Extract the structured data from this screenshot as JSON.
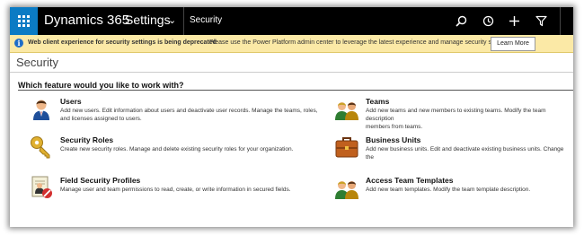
{
  "colors": {
    "nav_background": "#000000",
    "waffle_background": "#0b7bc4",
    "banner_background": "#fbe9a6",
    "info_icon": "#1e6dc8"
  },
  "nav": {
    "waffle_icon": "app-launcher-icon",
    "app_title": "Dynamics 365",
    "area": "Settings",
    "area_chevron": "⌄",
    "page": "Security",
    "actions": [
      {
        "icon": "search-icon"
      },
      {
        "icon": "recent-history-icon"
      },
      {
        "icon": "plus-icon"
      },
      {
        "icon": "filter-icon"
      }
    ]
  },
  "banner": {
    "icon": "info-icon",
    "icon_glyph": "i",
    "title": "Web client experience for security settings is being deprecated",
    "message": "Please use the Power Platform admin center to leverage the latest experience and manage security settings",
    "button": "Learn More"
  },
  "page": {
    "title": "Security",
    "section_title": "Which feature would you like to work with?"
  },
  "features": [
    {
      "name": "Users",
      "icon": "users-icon",
      "description_lines": [
        "Add new users. Edit information about users and deactivate user records. Manage the teams, roles,",
        "and licenses assigned to users."
      ]
    },
    {
      "name": "Teams",
      "icon": "teams-icon",
      "description_lines": [
        "Add new teams and new members to existing teams. Modify the team description",
        "members from teams."
      ]
    },
    {
      "name": "Security Roles",
      "icon": "security-roles-icon",
      "description_lines": [
        "Create new security roles. Manage and delete existing security roles for your organization."
      ]
    },
    {
      "name": "Business Units",
      "icon": "business-units-icon",
      "description_lines": [
        "Add new business units. Edit and deactivate existing business units. Change the"
      ]
    },
    {
      "name": "Field Security Profiles",
      "icon": "field-security-profiles-icon",
      "description_lines": [
        "Manage user and team permissions to read, create, or write information in secured fields."
      ]
    },
    {
      "name": "Access Team Templates",
      "icon": "access-team-templates-icon",
      "description_lines": [
        "Add new team templates. Modify the team template description."
      ]
    }
  ]
}
